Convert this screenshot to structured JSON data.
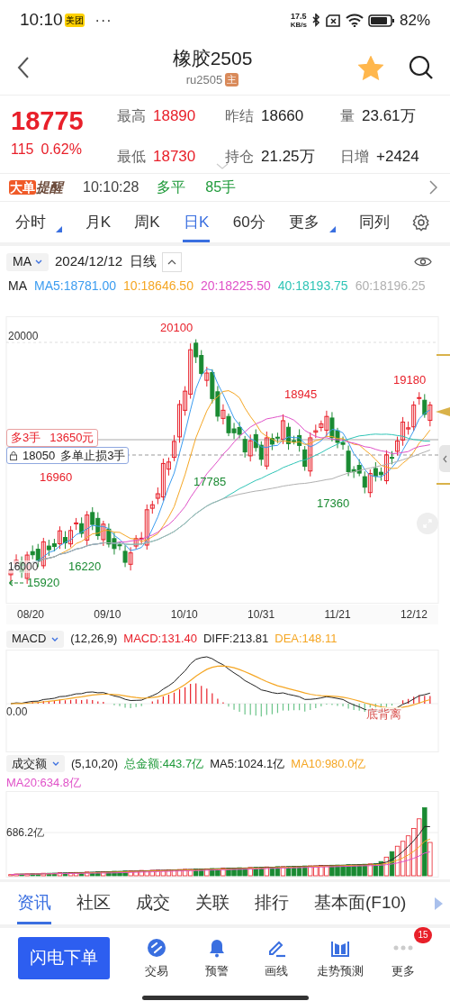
{
  "status_bar": {
    "time": "10:10",
    "app_badge": "美团",
    "more": "···",
    "net_speed_value": "17.5",
    "net_speed_unit": "KB/s",
    "battery": "82%"
  },
  "header": {
    "title": "橡胶2505",
    "code": "ru2505",
    "code_tag": "主",
    "favorite": true
  },
  "quote": {
    "price": "18775",
    "change": "115",
    "change_pct": "0.62%",
    "stats": [
      {
        "label": "最高",
        "value": "18890",
        "color": "#e8202a"
      },
      {
        "label": "昨结",
        "value": "18660",
        "color": "#222222"
      },
      {
        "label": "量",
        "value": "23.61万",
        "color": "#222222"
      },
      {
        "label": "最低",
        "value": "18730",
        "color": "#e8202a"
      },
      {
        "label": "持仓",
        "value": "21.25万",
        "color": "#222222"
      },
      {
        "label": "日增",
        "value": "+2424",
        "color": "#222222"
      }
    ]
  },
  "big_order": {
    "badge_a": "大单",
    "badge_b": "提醒",
    "time": "10:10:28",
    "action": "多平",
    "volume": "85手"
  },
  "period_tabs": [
    {
      "label": "分时",
      "selected": false,
      "has_menu": true
    },
    {
      "label": "月K",
      "selected": false,
      "has_menu": false
    },
    {
      "label": "周K",
      "selected": false,
      "has_menu": false
    },
    {
      "label": "日K",
      "selected": true,
      "has_menu": false
    },
    {
      "label": "60分",
      "selected": false,
      "has_menu": false
    },
    {
      "label": "更多",
      "selected": false,
      "has_menu": true
    },
    {
      "label": "同列",
      "selected": false,
      "has_menu": false
    }
  ],
  "ma_panel": {
    "indicator": "MA",
    "date": "2024/12/12",
    "period": "日线",
    "legend": [
      {
        "text": "MA",
        "color": "#222222"
      },
      {
        "text": "MA5:18781.00",
        "color": "#3b9cf0"
      },
      {
        "text": "10:18646.50",
        "color": "#f5a623"
      },
      {
        "text": "20:18225.50",
        "color": "#e052c8"
      },
      {
        "text": "40:18193.75",
        "color": "#2ec4b6"
      },
      {
        "text": "60:18196.25",
        "color": "#b0b0b0"
      }
    ]
  },
  "price_chart": {
    "y_labels": [
      "20000",
      "16000"
    ],
    "marks": [
      {
        "text": "20100",
        "kind": "high"
      },
      {
        "text": "18945",
        "kind": "high"
      },
      {
        "text": "19180",
        "kind": "high"
      },
      {
        "text": "16960",
        "kind": "high"
      },
      {
        "text": "17785",
        "kind": "low"
      },
      {
        "text": "17360",
        "kind": "low"
      },
      {
        "text": "16220",
        "kind": "low"
      },
      {
        "text": "15920",
        "kind": "low"
      }
    ],
    "orders": [
      {
        "kind": "open",
        "side": "多3手",
        "price": "13650元"
      },
      {
        "kind": "stop",
        "price": "18050",
        "side": "多单止损3手"
      }
    ],
    "x_labels": [
      "08/20",
      "09/10",
      "10/10",
      "10/31",
      "11/21",
      "12/12"
    ]
  },
  "macd": {
    "indicator": "MACD",
    "params": "(12,26,9)",
    "values": [
      {
        "text": "MACD:131.40",
        "color": "#e8202a"
      },
      {
        "text": "DIFF:213.81",
        "color": "#222222"
      },
      {
        "text": "DEA:148.11",
        "color": "#f5a623"
      }
    ],
    "zero_label": "0.00",
    "signal": "底背离"
  },
  "volume": {
    "indicator": "成交额",
    "params": "(5,10,20)",
    "values": [
      {
        "text": "总金额:443.7亿",
        "color": "#1f9a3a"
      },
      {
        "text": "MA5:1024.1亿",
        "color": "#222222"
      },
      {
        "text": "MA10:980.0亿",
        "color": "#f5a623"
      },
      {
        "text": "MA20:634.8亿",
        "color": "#e052c8"
      }
    ],
    "axis_label": "686.2亿"
  },
  "info_tabs": [
    {
      "label": "资讯",
      "selected": true
    },
    {
      "label": "社区",
      "selected": false
    },
    {
      "label": "成交",
      "selected": false
    },
    {
      "label": "关联",
      "selected": false
    },
    {
      "label": "排行",
      "selected": false
    },
    {
      "label": "基本面(F10)",
      "selected": false
    }
  ],
  "toolbar": {
    "primary": "闪电下单",
    "items": [
      {
        "label": "交易",
        "kind": "trade"
      },
      {
        "label": "预警",
        "kind": "alert"
      },
      {
        "label": "画线",
        "kind": "draw"
      },
      {
        "label": "走势预测",
        "kind": "forecast"
      },
      {
        "label": "更多",
        "kind": "more",
        "badge": "15"
      }
    ]
  }
}
